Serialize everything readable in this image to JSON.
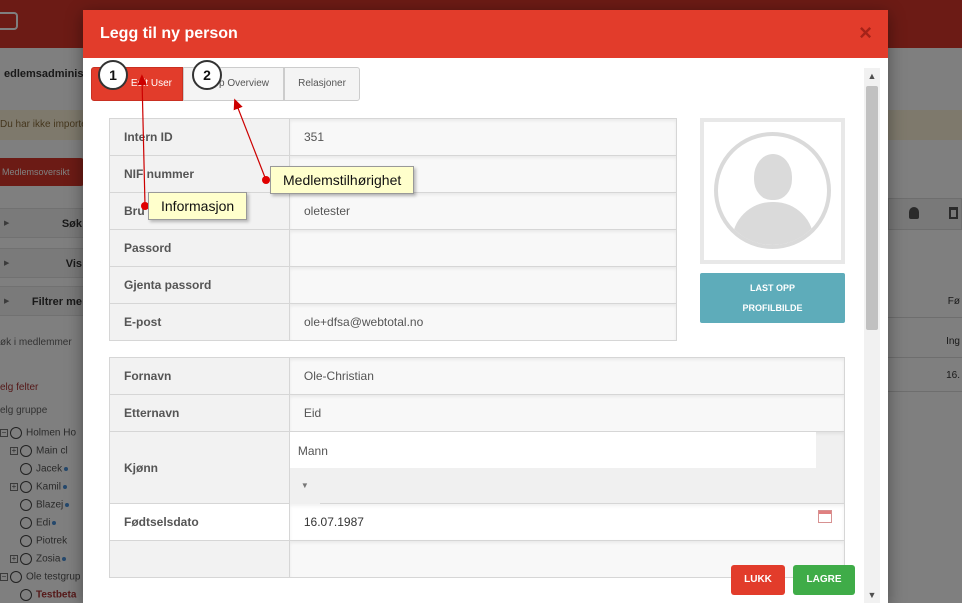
{
  "background": {
    "title": "edlemsadministra",
    "warning": "Du har ikke importe",
    "member_button": "Medlemsoversikt",
    "sidebar": [
      {
        "label": "Søk"
      },
      {
        "label": "Vis"
      },
      {
        "label": "Filtrer me"
      }
    ],
    "search_label": "øk i medlemmer",
    "velg_felter": "elg felter",
    "velg_gruppe": "elg gruppe",
    "tree": [
      "Holmen Ho",
      "Main cl",
      "Jacek",
      "Kamil",
      "Blazej",
      "Edi",
      "Piotrek",
      "Zosia",
      "Ole testgrup",
      "Testbeta"
    ],
    "right_cells": [
      "Fø",
      "Ing",
      "16."
    ]
  },
  "modal": {
    "title": "Legg til ny person",
    "close_glyph": "×",
    "tabs": [
      {
        "label": "Edit User",
        "active": true
      },
      {
        "label": "p Overview",
        "active": false
      },
      {
        "label": "Relasjoner",
        "active": false
      }
    ],
    "account_fields": [
      {
        "label": "Intern ID",
        "value": "351"
      },
      {
        "label": "NIF nummer",
        "value": ""
      },
      {
        "label": "Bru",
        "value": "oletester"
      },
      {
        "label": "Passord",
        "value": ""
      },
      {
        "label": "Gjenta passord",
        "value": ""
      },
      {
        "label": "E-post",
        "value": "ole+dfsa@webtotal.no"
      }
    ],
    "upload_button": [
      "LAST OPP",
      "PROFILBILDE"
    ],
    "person_fields": {
      "fornavn": {
        "label": "Fornavn",
        "value": "Ole-Christian"
      },
      "etternavn": {
        "label": "Etternavn",
        "value": "Eid"
      },
      "kjonn": {
        "label": "Kjønn",
        "value": "Mann"
      },
      "fodselsdato": {
        "label": "Fødtselsdato",
        "value": "16.07.1987"
      }
    },
    "buttons": {
      "close": "LUKK",
      "save": "LAGRE"
    }
  },
  "annotations": {
    "badges": [
      "1",
      "2"
    ],
    "callouts": [
      "Informasjon",
      "Medlemstilhørighet"
    ],
    "arrow_color": "#cc0000"
  },
  "colors": {
    "primary_red": "#e23c2b",
    "teal": "#5eacba",
    "green": "#3fac48"
  }
}
